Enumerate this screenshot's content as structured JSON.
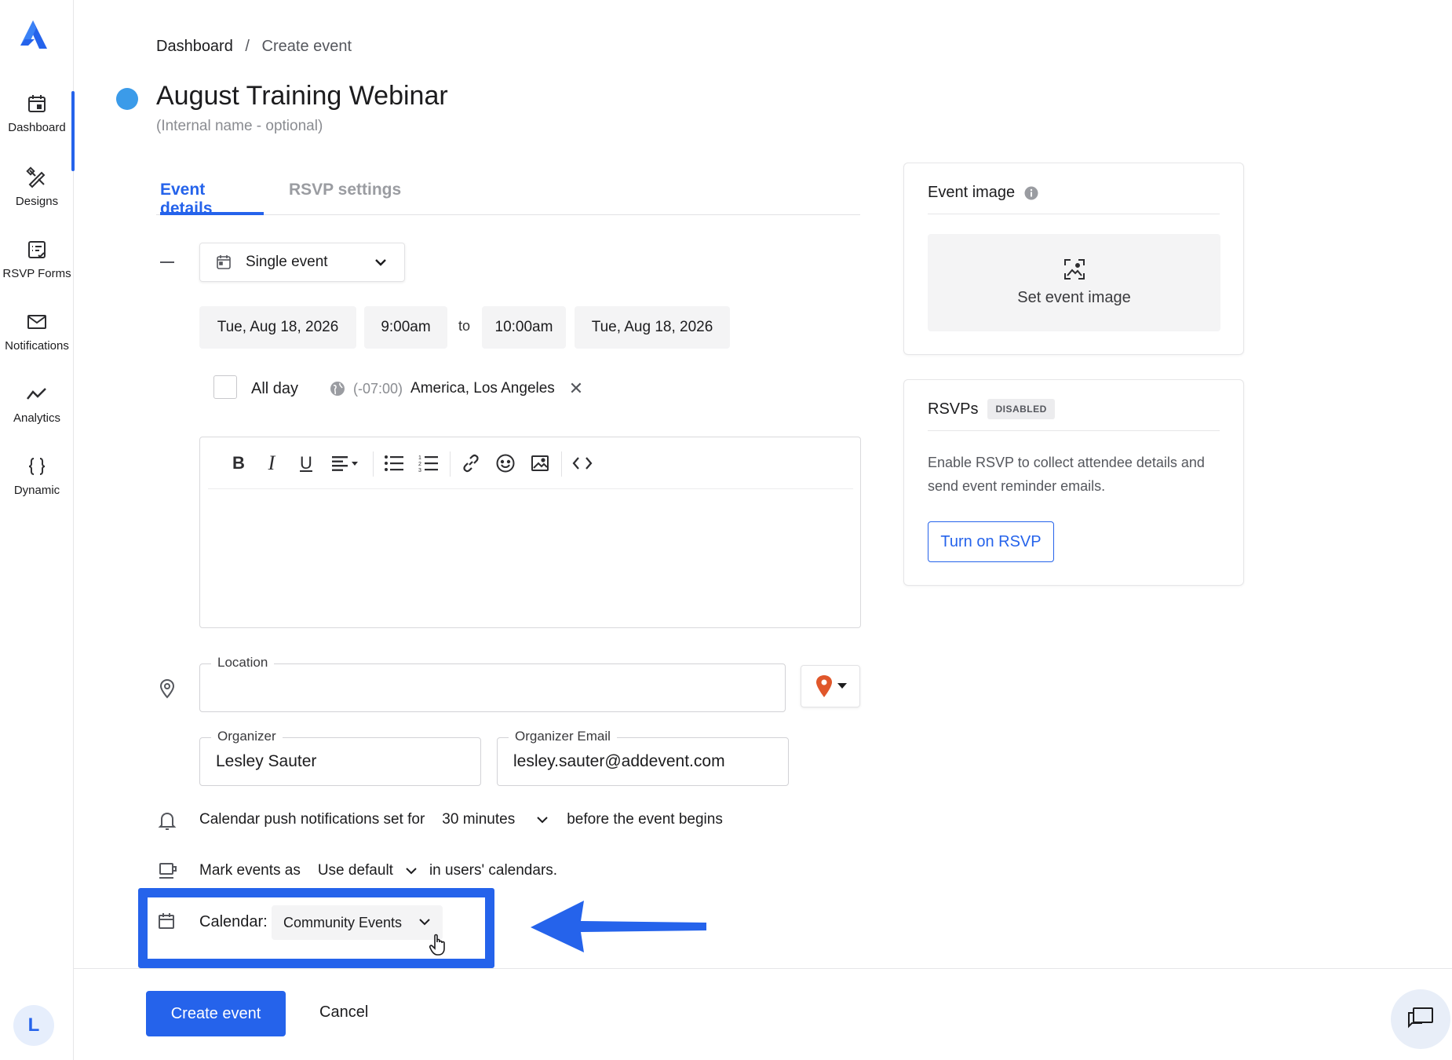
{
  "nav": {
    "items": [
      {
        "label": "Dashboard",
        "icon": "calendar-icon"
      },
      {
        "label": "Designs",
        "icon": "designs-icon"
      },
      {
        "label": "RSVP Forms",
        "icon": "rsvp-forms-icon"
      },
      {
        "label": "Notifications",
        "icon": "envelope-icon"
      },
      {
        "label": "Analytics",
        "icon": "analytics-icon"
      },
      {
        "label": "Dynamic",
        "icon": "braces-icon"
      }
    ],
    "avatar_initial": "L"
  },
  "breadcrumb": {
    "root": "Dashboard",
    "separator": "/",
    "current": "Create event"
  },
  "event": {
    "title": "August Training Webinar",
    "internal_placeholder": "(Internal name - optional)",
    "dot_color": "#3b9be9"
  },
  "tabs": [
    {
      "label": "Event details",
      "active": true
    },
    {
      "label": "RSVP settings",
      "active": false
    }
  ],
  "schedule": {
    "type": "Single event",
    "start_date": "Tue, Aug 18, 2026",
    "start_time": "9:00am",
    "to": "to",
    "end_time": "10:00am",
    "end_date": "Tue, Aug 18, 2026",
    "all_day_label": "All day",
    "all_day": false,
    "tz_offset": "(-07:00)",
    "tz_name": "America, Los Angeles"
  },
  "editor": {
    "tools": [
      "bold-icon",
      "italic-icon",
      "underline-icon",
      "align-icon",
      "bullet-list-icon",
      "numbered-list-icon",
      "link-icon",
      "emoji-icon",
      "image-icon",
      "code-icon"
    ],
    "bold": "B",
    "italic": "I",
    "underline": "U"
  },
  "location": {
    "legend": "Location",
    "value": ""
  },
  "organizer": {
    "legend": "Organizer",
    "value": "Lesley Sauter"
  },
  "organizer_email": {
    "legend": "Organizer Email",
    "value": "lesley.sauter@addevent.com"
  },
  "notifications": {
    "prefix": "Calendar push notifications set for",
    "value": "30 minutes",
    "suffix": "before the event begins"
  },
  "mark_events": {
    "prefix": "Mark events as",
    "value": "Use default",
    "suffix": "in users' calendars."
  },
  "calendar": {
    "label": "Calendar:",
    "value": "Community Events"
  },
  "footer": {
    "create_label": "Create event",
    "cancel_label": "Cancel"
  },
  "event_image": {
    "title": "Event image",
    "set_label": "Set event image"
  },
  "rsvps": {
    "title": "RSVPs",
    "badge": "DISABLED",
    "description": "Enable RSVP to collect attendee details and send event reminder emails.",
    "button_label": "Turn on RSVP"
  },
  "colors": {
    "accent": "#2563eb",
    "highlight": "#2563eb",
    "pin": "#e0572b"
  }
}
